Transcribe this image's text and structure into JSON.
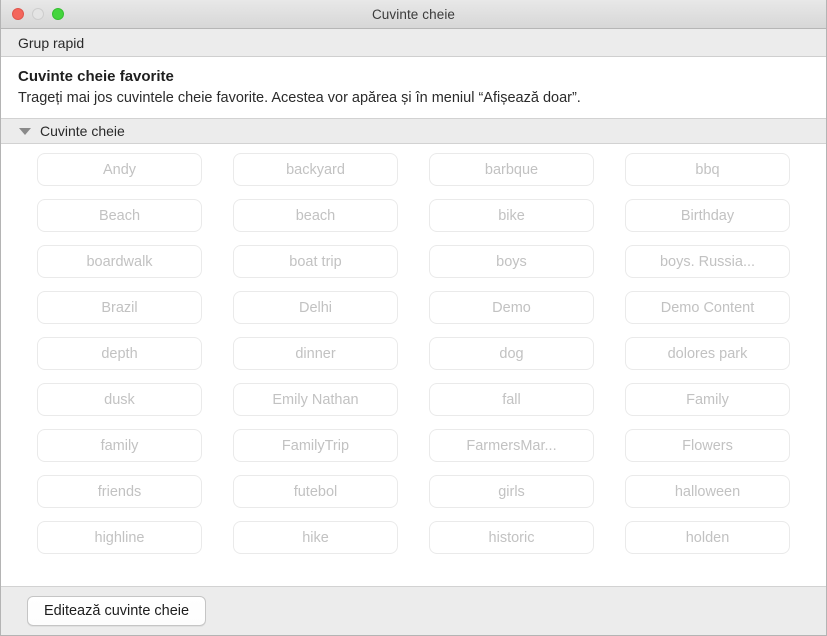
{
  "window": {
    "title": "Cuvinte cheie",
    "traffic_lights": [
      {
        "name": "close",
        "color": "#f4665c"
      },
      {
        "name": "minimize",
        "color": "#e4e4e4"
      },
      {
        "name": "zoom",
        "color": "#44d53d"
      }
    ]
  },
  "toolbar": {
    "label": "Grup rapid"
  },
  "favorites": {
    "title": "Cuvinte cheie favorite",
    "description": "Trageți mai jos cuvintele cheie favorite. Acestea vor apărea și în meniul “Afișează doar”."
  },
  "section": {
    "title": "Cuvinte cheie",
    "expanded": true,
    "disclosure_icon": "triangle-down-icon"
  },
  "keywords": [
    "Andy",
    "backyard",
    "barbque",
    "bbq",
    "Beach",
    "beach",
    "bike",
    "Birthday",
    "boardwalk",
    "boat trip",
    "boys",
    "boys. Russia...",
    "Brazil",
    "Delhi",
    "Demo",
    "Demo Content",
    "depth",
    "dinner",
    "dog",
    "dolores park",
    "dusk",
    "Emily Nathan",
    "fall",
    "Family",
    "family",
    "FamilyTrip",
    "FarmersMar...",
    "Flowers",
    "friends",
    "futebol",
    "girls",
    "halloween",
    "highline",
    "hike",
    "historic",
    "holden"
  ],
  "bottom": {
    "edit_button": "Editează cuvinte cheie"
  }
}
